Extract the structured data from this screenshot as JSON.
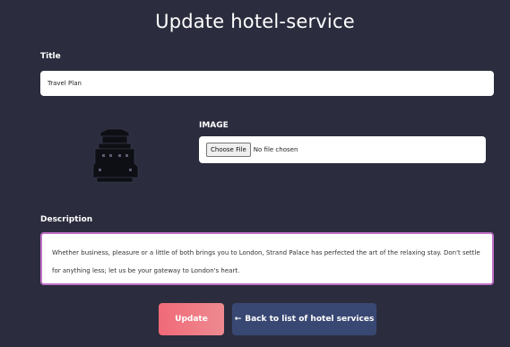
{
  "page": {
    "title": "Update hotel-service"
  },
  "form": {
    "title_label": "Title",
    "title_value": "Travel Plan",
    "image_label": "IMAGE",
    "file_button_label": "Choose File",
    "file_status": "No file chosen",
    "description_label": "Description",
    "description_value": "Whether business, pleasure or a little of both brings you to London, Strand Palace has perfected the art of the relaxing stay. Don't settle for anything less; let us be your gateway to London's heart."
  },
  "actions": {
    "update_label": "Update",
    "back_arrow": "←",
    "back_label": "Back to list of hotel services"
  },
  "colors": {
    "background": "#2b2d3e",
    "update_button": "#f06a78",
    "back_button": "#394873",
    "description_border": "#c06fc7"
  },
  "icons": {
    "preview_image": "hotel-image-thumbnail"
  }
}
